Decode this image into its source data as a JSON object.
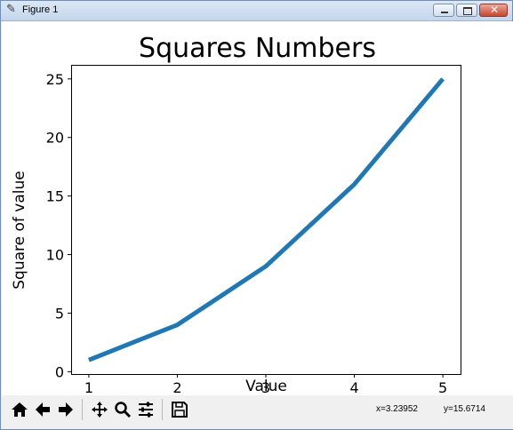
{
  "window": {
    "title": "Figure 1",
    "icon": "feather-icon"
  },
  "chart_data": {
    "type": "line",
    "title": "Squares Numbers",
    "xlabel": "Value",
    "ylabel": "Square of value",
    "x": [
      1,
      2,
      3,
      4,
      5
    ],
    "series": [
      {
        "values": [
          1,
          4,
          9,
          16,
          25
        ],
        "color": "#1f77b4"
      }
    ],
    "xlim": [
      0.8,
      5.2
    ],
    "ylim": [
      -0.2,
      26.2
    ],
    "xticks": [
      1,
      2,
      3,
      4,
      5
    ],
    "yticks": [
      0,
      5,
      10,
      15,
      20,
      25
    ],
    "grid": false,
    "legend": "none"
  },
  "toolbar": {
    "buttons": [
      {
        "name": "home-button",
        "icon": "home-icon"
      },
      {
        "name": "back-button",
        "icon": "arrow-left-icon"
      },
      {
        "name": "forward-button",
        "icon": "arrow-right-icon"
      },
      {
        "name": "pan-button",
        "icon": "move-icon"
      },
      {
        "name": "zoom-button",
        "icon": "magnifier-icon"
      },
      {
        "name": "configure-subplots-button",
        "icon": "sliders-icon"
      },
      {
        "name": "save-button",
        "icon": "floppy-disk-icon"
      }
    ],
    "x_readout": "x=3.23952",
    "y_readout": "y=15.6714"
  }
}
